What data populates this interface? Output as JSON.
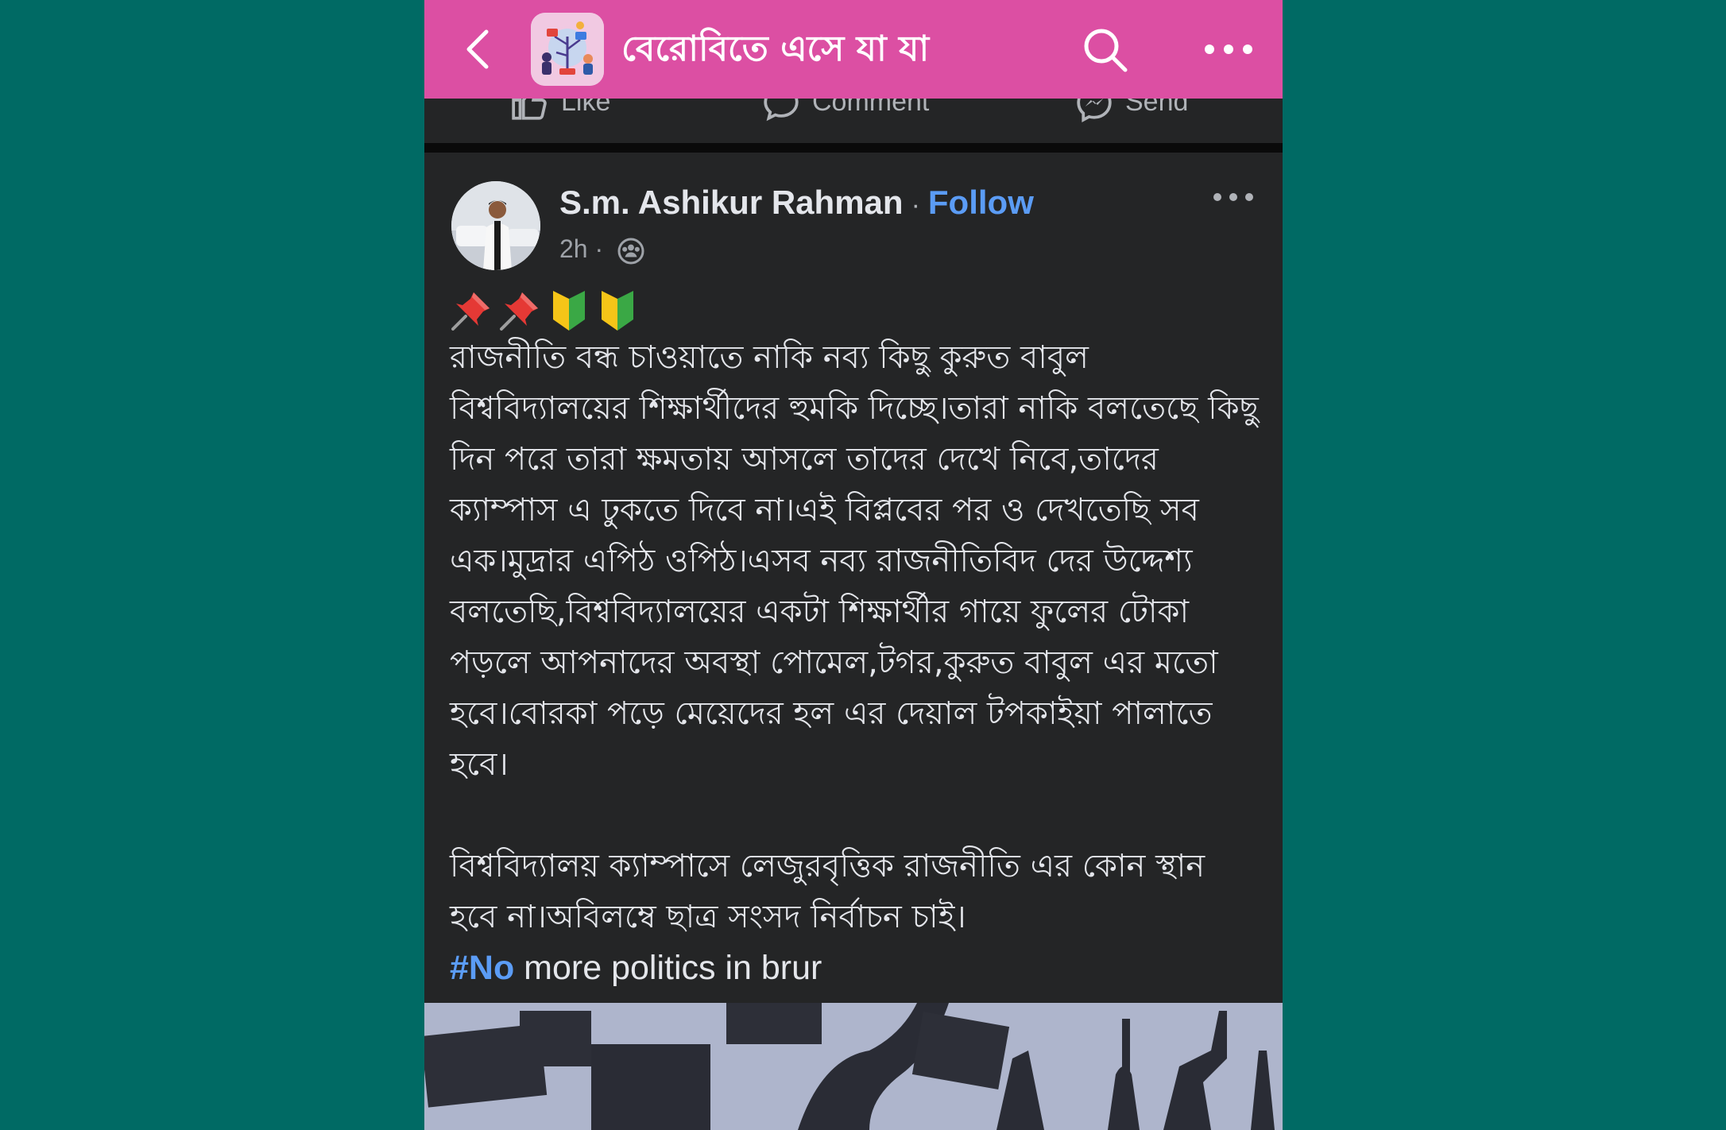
{
  "appbar": {
    "title": "বেরোবিতে এসে যা যা দে...",
    "background": "#dc4fa3",
    "back_icon": "chevron-left-icon",
    "search_icon": "search-icon",
    "more_icon": "more-horizontal-icon"
  },
  "prev_post_actions": [
    {
      "label": "Like",
      "icon": "like-icon"
    },
    {
      "label": "Comment",
      "icon": "comment-icon"
    },
    {
      "label": "Send",
      "icon": "send-icon"
    }
  ],
  "post": {
    "author": "S.m. Ashikur Rahman",
    "separator": "·",
    "follow_label": "Follow",
    "time": "2h ·",
    "audience_icon": "group-audience-icon",
    "emojis": [
      "pushpin",
      "pushpin",
      "beginner-symbol",
      "beginner-symbol"
    ],
    "paragraph_1": "রাজনীতি বন্ধ চাওয়াতে নাকি নব্য কিছু কুরুত বাবুল বিশ্ববিদ্যালয়ের শিক্ষার্থীদের হুমকি দিচ্ছে।তারা নাকি বলতেছে কিছু দিন পরে তারা ক্ষমতায় আসলে তাদের দেখে নিবে,তাদের ক্যাম্পাস এ ঢুকতে দিবে না।এই বিপ্লবের পর ও দেখতেছি সব এক।মুদ্রার এপিঠ ওপিঠ।এসব নব্য রাজনীতিবিদ দের উদ্দেশ্য বলতেছি,বিশ্ববিদ্যালয়ের একটা শিক্ষার্থীর গায়ে ফুলের টোকা পড়লে আপনাদের অবস্থা পোমেল,টগর,কুরুত বাবুল এর মতো হবে।বোরকা পড়ে মেয়েদের হল এর দেয়াল টপকাইয়া পালাতে হবে।",
    "paragraph_2": "বিশ্ববিদ্যালয় ক্যাম্পাসে লেজুরবৃত্তিক  রাজনীতি এর কোন স্থান হবে না।অবিলম্বে ছাত্র সংসদ নির্বাচন চাই।",
    "hashtag": "#No",
    "hashtag_rest": " more politics in brur"
  },
  "colors": {
    "background": "#006a64",
    "post_bg": "#242526",
    "text": "#e4e6eb",
    "link": "#5b9cf5"
  }
}
